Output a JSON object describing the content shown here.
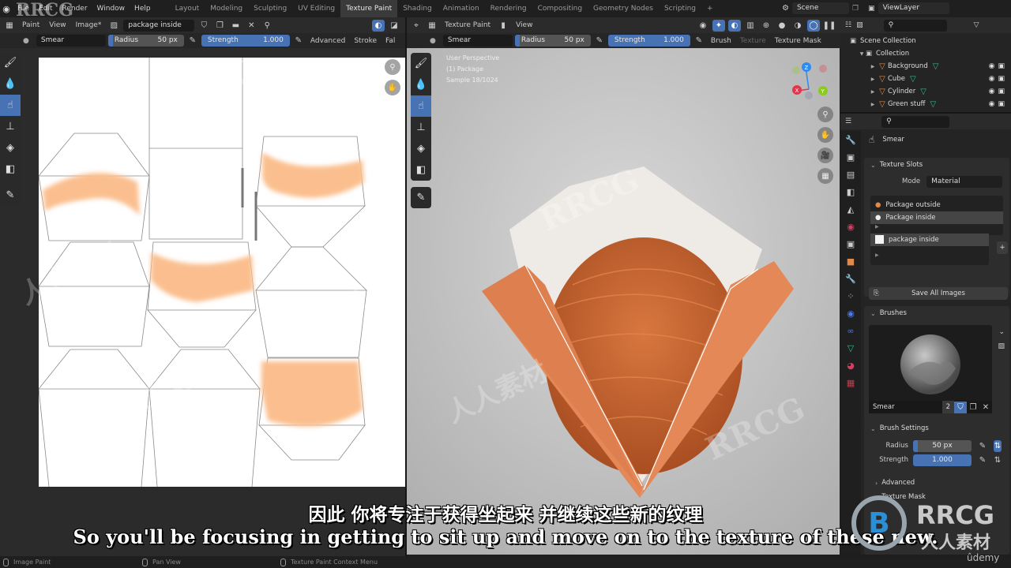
{
  "menu": [
    "File",
    "Edit",
    "Render",
    "Window",
    "Help"
  ],
  "workspaces": [
    "Layout",
    "Modeling",
    "Sculpting",
    "UV Editing",
    "Texture Paint",
    "Shading",
    "Animation",
    "Rendering",
    "Compositing",
    "Geometry Nodes",
    "Scripting",
    "+"
  ],
  "active_workspace": "Texture Paint",
  "scene": {
    "name": "Scene",
    "view_layer": "ViewLayer"
  },
  "image_editor": {
    "header": {
      "mode": "Paint",
      "view": "View",
      "image_menu": "Image*",
      "image_name": "package inside"
    },
    "tool_settings": {
      "brush": "Smear",
      "radius_label": "Radius",
      "radius_value": "50 px",
      "strength_label": "Strength",
      "strength_value": "1.000",
      "advanced": "Advanced",
      "stroke": "Stroke",
      "falloff": "Fal"
    },
    "tools": [
      "brush-icon",
      "blur-icon",
      "smear-icon",
      "clone-icon",
      "fill-icon",
      "mask-icon",
      "annotate-icon"
    ],
    "active_tool": "smear-icon"
  },
  "viewport": {
    "header": {
      "mode": "Texture Paint",
      "view": "View"
    },
    "tool_settings": {
      "brush": "Smear",
      "radius_label": "Radius",
      "radius_value": "50 px",
      "strength_label": "Strength",
      "strength_value": "1.000",
      "brush_menu": "Brush",
      "texture": "Texture",
      "texture_mask": "Texture Mask"
    },
    "overlay": {
      "perspective": "User Perspective",
      "object": "(1) Package",
      "sample": "Sample 18/1024"
    },
    "gizmo": {
      "z": "Z",
      "x": "X",
      "y": "Y",
      "colors": {
        "x": "#e8344b",
        "y": "#8bcb1f",
        "z": "#2d8bf0"
      }
    }
  },
  "outliner": {
    "root": "Scene Collection",
    "collection": "Collection",
    "items": [
      "Background",
      "Cube",
      "Cylinder",
      "Green stuff"
    ]
  },
  "properties": {
    "active_brush": "Smear",
    "texture_slots": {
      "title": "Texture Slots",
      "mode_label": "Mode",
      "mode_value": "Material",
      "materials": [
        "Package outside",
        "Package inside"
      ],
      "selected_material": "Package inside",
      "images": [
        "package inside"
      ],
      "save_all": "Save All Images"
    },
    "brushes": {
      "title": "Brushes",
      "name": "Smear",
      "users": "2"
    },
    "brush_settings": {
      "title": "Brush Settings",
      "radius_label": "Radius",
      "radius_value": "50 px",
      "strength_label": "Strength",
      "strength_value": "1.000",
      "advanced": "Advanced",
      "texture_mask": "Texture Mask"
    }
  },
  "statusbar": {
    "left": "Image Paint",
    "middle": "Pan View",
    "right": "Texture Paint Context Menu"
  },
  "subtitles": {
    "cn": "因此 你将专注于获得坐起来 并继续这些新的纹理",
    "en": "So you'll be focusing in getting to sit up and move on to the texture of these new."
  },
  "watermarks": {
    "brand": "RRCG",
    "brand_cn": "人人素材",
    "platform": "ûdemy"
  },
  "colors": {
    "accent": "#4772b3",
    "paint": "#fbbf8f",
    "box": "#e48858"
  }
}
